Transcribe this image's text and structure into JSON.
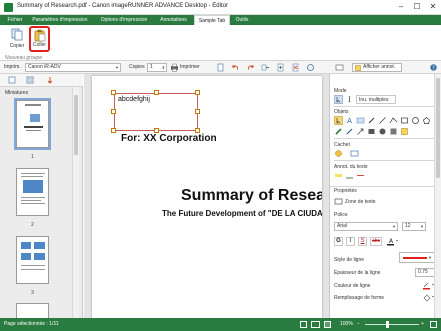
{
  "window": {
    "title": "Summary of Research.pdf - Canon imageRUNNER ADVANCE Desktop - Editor",
    "minimize": "–",
    "maximize": "☐",
    "close": "✕"
  },
  "ribbon_tabs": [
    "Fichier",
    "Paramètres d'impression",
    "Options d'impression",
    "Annotations",
    "Sample Tab",
    "Outils"
  ],
  "active_tab": "Sample Tab",
  "ribbon": {
    "copy_label": "Copier",
    "paste_label": "Coller",
    "group_label": "Nouveau groupe"
  },
  "toolbar": {
    "printer_label": "Imprim.",
    "printer_value": "Canon iR-ADV",
    "copies_label": "Copies",
    "copies_value": "1",
    "print_button": "Imprimer",
    "show_annotations": "Afficher annot."
  },
  "left_pane": {
    "title": "Miniatures",
    "page_numbers": [
      "1",
      "2",
      "3"
    ]
  },
  "document": {
    "text_box": "abcdefghij",
    "company": "For: XX Corporation",
    "heading": "Summary of Research",
    "subheading": "The Future Development of \"DE LA CIUDAD"
  },
  "right_pane": {
    "mode_label": "Mode",
    "mode_multiple": "Inu. multiples",
    "objects_label": "Objets",
    "stamp_label": "Cachet",
    "text_annotation_label": "Annot. du texte",
    "properties_label": "Propriétés",
    "text_zone_label": "Zone de texte",
    "font_label": "Police",
    "font_value": "Arial",
    "font_size": "12",
    "bold": "G",
    "italic": "I",
    "underline": "S",
    "strike": "abc",
    "line_style_label": "Style de ligne",
    "line_thickness_label": "Épaisseur de la ligne",
    "line_thickness_value": "0.75",
    "line_color_label": "Couleur de ligne",
    "fill_color_label": "Remplissage de forme"
  },
  "status": {
    "page_selected": "Page sélectionnée : 1/11",
    "zoom": "100%"
  },
  "colors": {
    "accent_green": "#2a7b3f",
    "highlight_red": "#e0201a",
    "selection_blue": "#7fa8d8"
  }
}
